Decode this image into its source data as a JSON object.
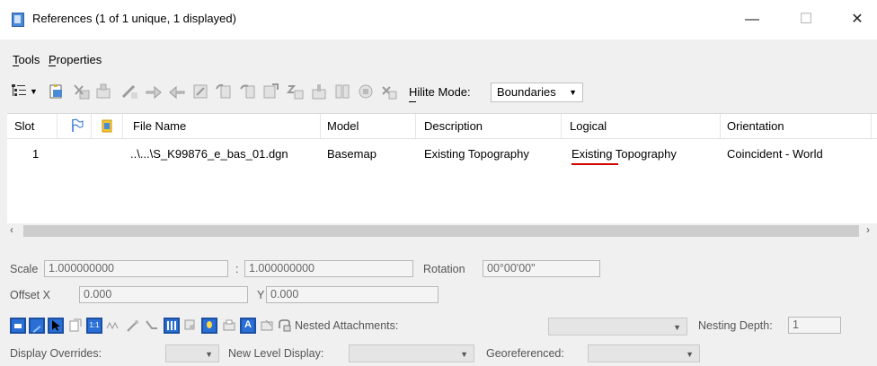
{
  "window": {
    "title": "References (1 of 1 unique, 1 displayed)",
    "minimize": "—",
    "maximize": "☐",
    "close": "✕"
  },
  "menu": {
    "tools": "Tools",
    "properties": "Properties"
  },
  "toolbar": {
    "hilite_label": "Hilite Mode:",
    "hilite_value": "Boundaries"
  },
  "table": {
    "headers": [
      "Slot",
      "File Name",
      "Model",
      "Description",
      "Logical",
      "Orientation"
    ],
    "rows": [
      {
        "slot": "1",
        "file_name": "..\\...\\S_K99876_e_bas_01.dgn",
        "model": "Basemap",
        "description": "Existing Topography",
        "logical": "Existing Topography",
        "orientation": "Coincident - World"
      }
    ]
  },
  "props": {
    "scale_label": "Scale",
    "scale_value": "1.000000000",
    "scale_sep": ":",
    "scale_value2": "1.000000000",
    "rotation_label": "Rotation",
    "rotation_value": "00°00'00\"",
    "offset_x_label": "Offset X",
    "offset_x_value": "0.000",
    "y_label": "Y",
    "y_value": "0.000",
    "nested_label": "Nested Attachments:",
    "nesting_depth_label": "Nesting Depth:",
    "nesting_depth_value": "1",
    "display_overrides_label": "Display Overrides:",
    "new_level_label": "New Level Display:",
    "georef_label": "Georeferenced:"
  },
  "colors": {
    "accent": "#2a6fd6",
    "spell_underline": "#d00000"
  }
}
